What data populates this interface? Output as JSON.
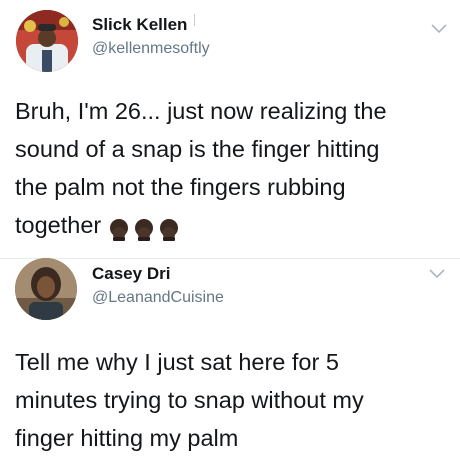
{
  "tweets": [
    {
      "user": {
        "display_name": "Slick Kellen",
        "handle": "@kellenmesoftly",
        "avatar_icon": "avatar-photo-icon"
      },
      "text_lines": [
        "Bruh, I'm 26... just now realizing the",
        "sound of a snap is the finger hitting",
        "the palm not the fingers rubbing",
        "together"
      ],
      "emoji_icons": [
        "facepalm-emoji-icon",
        "facepalm-emoji-icon",
        "facepalm-emoji-icon"
      ]
    },
    {
      "user": {
        "display_name": "Casey Dri",
        "handle": "@LeanandCuisine",
        "avatar_icon": "avatar-photo-icon"
      },
      "text_lines": [
        "Tell me why I just sat here for 5",
        "minutes trying to snap without my",
        "finger hitting my palm"
      ]
    }
  ],
  "colors": {
    "text": "#14171a",
    "handle": "#657786",
    "caret": "#aab8c2",
    "background": "#ffffff"
  }
}
